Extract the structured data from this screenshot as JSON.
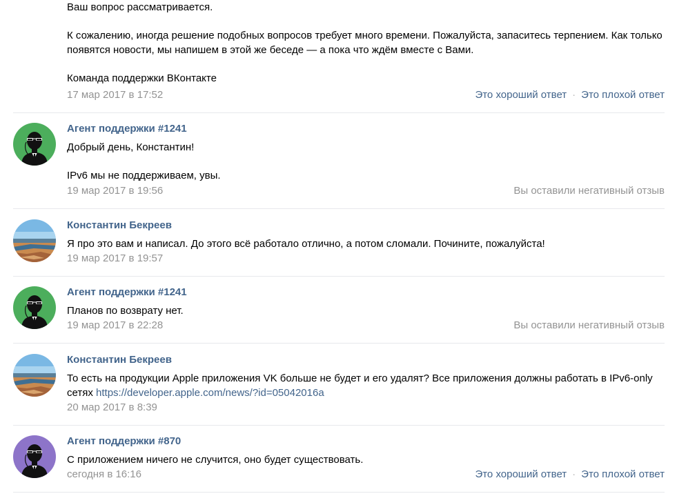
{
  "colors": {
    "author_link": "#42648b",
    "muted": "#939393",
    "divider": "#e7e8ec",
    "agent_avatar_green": "#4cae5c",
    "agent_avatar_purple": "#8d74c9"
  },
  "messages": [
    {
      "paragraphs": [
        "Ваш вопрос рассматривается.",
        "К сожалению, иногда решение подобных вопросов требует много времени. Пожалуйста, запаситесь терпением. Как только появятся новости, мы напишем в этой же беседе — а пока что ждём вместе с Вами.",
        "Команда поддержки ВКонтакте"
      ],
      "date": "17 мар 2017 в 17:52",
      "good_answer": "Это хороший ответ",
      "bad_answer": "Это плохой ответ"
    },
    {
      "author": "Агент поддержки #1241",
      "avatar_icon": "agent-avatar-icon",
      "paragraphs": [
        "Добрый день, Константин!",
        "IPv6 мы не поддерживаем, увы."
      ],
      "date": "19 мар 2017 в 19:56",
      "feedback": "Вы оставили негативный отзыв"
    },
    {
      "author": "Константин Бекреев",
      "avatar_icon": "user-avatar-photo",
      "text": "Я про это вам и написал. До этого всё работало отлично, а потом сломали. Почините, пожалуйста!",
      "date": "19 мар 2017 в 19:57"
    },
    {
      "author": "Агент поддержки #1241",
      "avatar_icon": "agent-avatar-icon",
      "text": "Планов по возврату нет.",
      "date": "19 мар 2017 в 22:28",
      "feedback": "Вы оставили негативный отзыв"
    },
    {
      "author": "Константин Бекреев",
      "avatar_icon": "user-avatar-photo",
      "text": "То есть на продукции Apple приложения VK больше не будет и его удалят? Все приложения должны работать в IPv6-only сетях",
      "link": "https://developer.apple.com/news/?id=05042016a",
      "date": "20 мар 2017 в 8:39"
    },
    {
      "author": "Агент поддержки #870",
      "avatar_icon": "agent-avatar-icon",
      "text": "С приложением ничего не случится, оно будет существовать.",
      "date": "сегодня в 16:16",
      "good_answer": "Это хороший ответ",
      "bad_answer": "Это плохой ответ"
    }
  ]
}
